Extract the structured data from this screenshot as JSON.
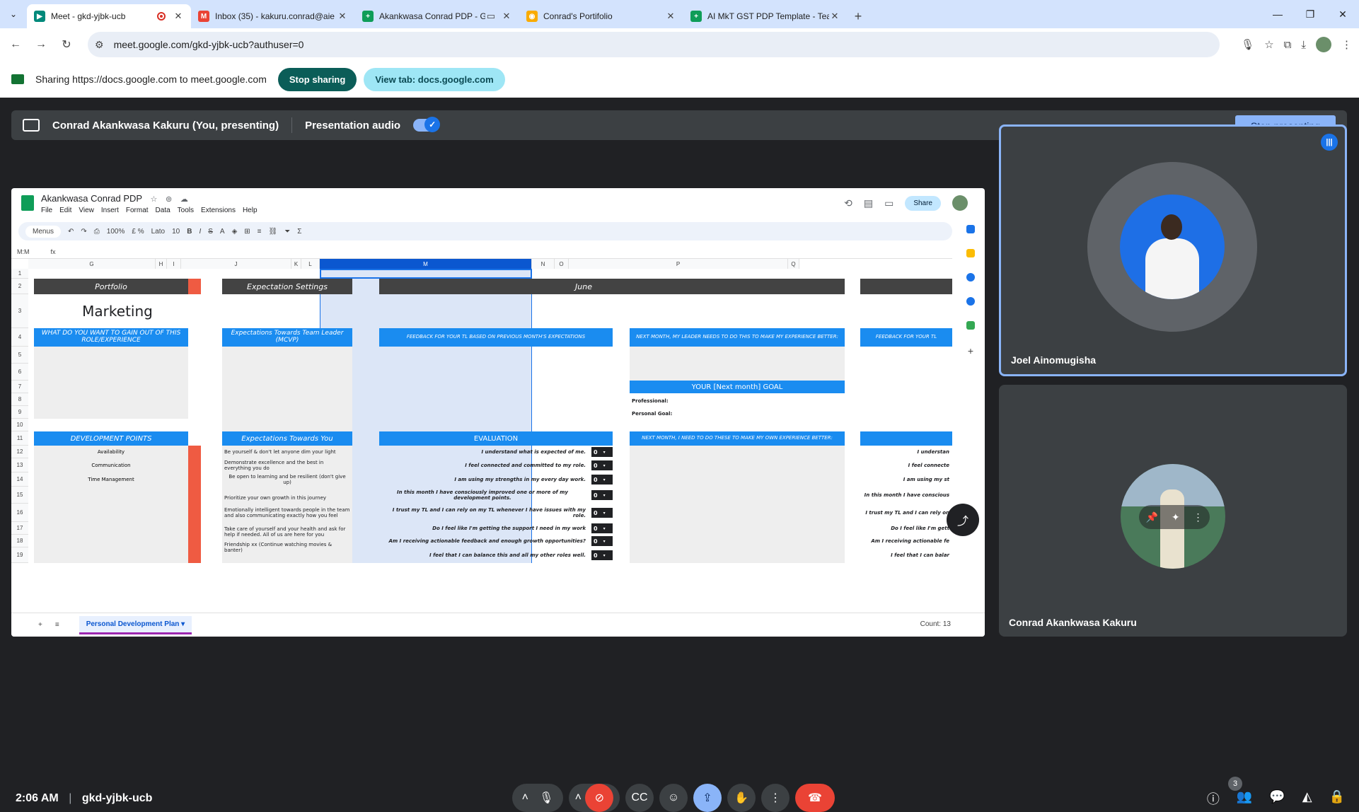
{
  "browser": {
    "tabs": [
      {
        "title": "Meet - gkd-yjbk-ucb",
        "favicon_color": "#00897b",
        "active": true
      },
      {
        "title": "Inbox (35) - kakuru.conrad@aie",
        "favicon_color": "#ea4335"
      },
      {
        "title": "Akankwasa Conrad PDP - G",
        "favicon_color": "#0f9d58"
      },
      {
        "title": "Conrad's Portifolio",
        "favicon_color": "#f9ab00"
      },
      {
        "title": "AI MkT GST PDP Template - Tea",
        "favicon_color": "#0f9d58"
      }
    ],
    "url": "meet.google.com/gkd-yjbk-ucb?authuser=0"
  },
  "sharing_bar": {
    "message": "Sharing https://docs.google.com to meet.google.com",
    "stop_label": "Stop sharing",
    "view_tab_label": "View tab: docs.google.com"
  },
  "presenting_bar": {
    "presenter": "Conrad Akankwasa Kakuru (You, presenting)",
    "audio_label": "Presentation audio",
    "stop_label": "Stop presenting"
  },
  "sheet": {
    "title": "Akankwasa Conrad PDP",
    "menu": [
      "File",
      "Edit",
      "View",
      "Insert",
      "Format",
      "Data",
      "Tools",
      "Extensions",
      "Help"
    ],
    "share_label": "Share",
    "search_label": "Menus",
    "zoom": "100%",
    "font": "Lato",
    "font_size": "10",
    "name_box": "M:M",
    "fx": "fx",
    "columns": [
      "G",
      "H",
      "I",
      "J",
      "K",
      "L",
      "M",
      "N",
      "O",
      "P",
      "Q"
    ],
    "rows": [
      "1",
      "2",
      "3",
      "4",
      "5",
      "6",
      "7",
      "8",
      "9",
      "10",
      "11",
      "12",
      "13",
      "14",
      "15",
      "16",
      "17",
      "18",
      "19"
    ],
    "portfolio_header": "Portfolio",
    "expectation_header": "Expectation Settings",
    "june_header": "June",
    "marketing": "Marketing",
    "gain_header": "WHAT DO YOU WANT TO GAIN OUT OF THIS ROLE/EXPERIENCE",
    "tl_header": "Expectations Towards Team Leader (MCVP)",
    "feedback_header": "FEEDBACK FOR YOUR TL BASED ON PREVIOUS MONTH'S EXPECTATIONS",
    "next_leader_header": "NEXT MONTH, MY LEADER NEEDS TO DO THIS TO MAKE MY EXPERIENCE BETTER:",
    "feedback_short": "FEEDBACK FOR YOUR TL",
    "goal_header": "YOUR [Next month] GOAL",
    "professional_label": "Professional:",
    "personal_goal_label": "Personal Goal:",
    "dev_points_header": "DEVELOPMENT POINTS",
    "towards_you_header": "Expectations Towards You",
    "evaluation_header": "EVALUATION",
    "next_me_header": "NEXT MONTH, I NEED TO DO THESE TO MAKE MY OWN EXPERIENCE BETTER:",
    "dev_points": [
      "Availability",
      "Communication",
      "Time Management"
    ],
    "towards_you": [
      "Be yourself & don't let anyone dim your light",
      "Demonstrate excellence and the best in everything you do",
      "Be open to learning and be resilient (don't give up)",
      "Prioritize your own growth in this journey",
      "Emotionally intelligent towards people in the team and also communicating exactly how you feel",
      "Take care of yourself and your health and ask for help if needed. All of us are here for you",
      "Friendship xx (Continue watching movies & banter)"
    ],
    "evaluation": [
      "I understand what is expected of me.",
      "I feel connected and committed to my role.",
      "I am using my strengths in my every day work.",
      "In this month I have consciously improved one or more of my development points.",
      "I trust my TL and I can rely on my TL whenever I have issues with my role.",
      "Do I feel like I'm getting the support I need in my work",
      "Am I receiving actionable feedback and enough growth opportunities?",
      "I feel that I can balance this and all my other roles well."
    ],
    "evaluation_truncated": [
      "I understan",
      "I feel connecte",
      "I am using my st",
      "In this month I have conscious",
      "I trust my TL and I can rely on",
      "Do I feel like I'm gett",
      "Am I receiving actionable fe",
      "I feel that I can balar"
    ],
    "score": "0",
    "sheet_tab": "Personal Development Plan",
    "count": "Count: 13"
  },
  "participants": [
    {
      "name": "Joel Ainomugisha"
    },
    {
      "name": "Conrad Akankwasa Kakuru"
    }
  ],
  "footer": {
    "time": "2:06 AM",
    "meeting_code": "gkd-yjbk-ucb",
    "people_count": "3"
  }
}
